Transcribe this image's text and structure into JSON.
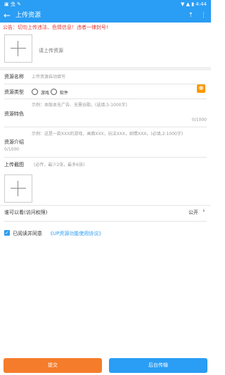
{
  "status": {
    "left": "▣ 虫 ✎",
    "right": "▼ ▲ ▮ 4:44"
  },
  "appbar": {
    "title": "上传资源",
    "back_icon": "←"
  },
  "notice": "公告：切勿上传违法、色情信息！违者一律封号!",
  "upload": {
    "placeholder": "请上传资源"
  },
  "form": {
    "name_label": "资源名称",
    "name_placeholder": "上传资源自动填写",
    "type_label": "资源类型",
    "type_option1": "游戏",
    "type_option2": "软件",
    "feature_label": "资源特色",
    "feature_placeholder": "示例：本版本无广告、无需谷歌。(选填,5-1000字)",
    "feature_counter": "0/1000",
    "intro_label": "资源介绍",
    "intro_placeholder": "示例：这是一款XXX的游戏，画面XXX，玩法XXX，剧情XXX。(必填,2-1000字)",
    "intro_counter": "0/1000",
    "screenshot_label": "上传截图",
    "screenshot_hint": "(必传，最少2张，最多6张)",
    "visibility_label": "谁可以看(访问权限)",
    "visibility_value": "公开"
  },
  "agreement": {
    "check_label": "已阅读并同意",
    "link": "《UP资源功能使用协议》"
  },
  "buttons": {
    "submit": "提交",
    "background": "后台传输"
  },
  "colors": {
    "primary": "#2a9df4",
    "submit": "#f57c2a",
    "notice": "#e53935"
  }
}
